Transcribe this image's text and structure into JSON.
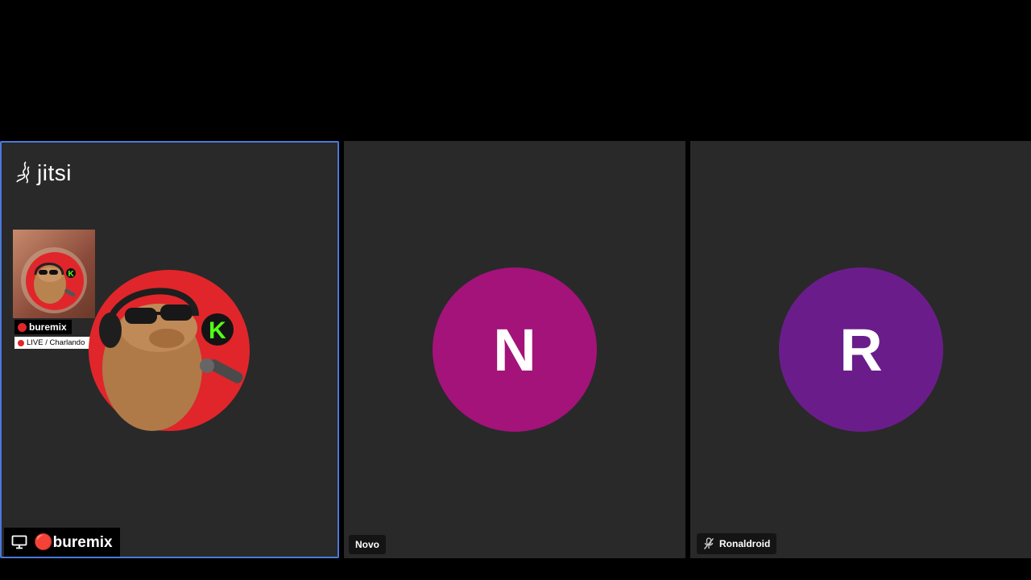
{
  "branding": {
    "watermark": "jitsi"
  },
  "participants": [
    {
      "name": "🔴buremix",
      "stream_overlay": {
        "channel": "buremix",
        "status": "LIVE / Charlando"
      },
      "screen_share": true,
      "active_speaker": true
    },
    {
      "name": "Novo",
      "initial": "N",
      "avatar_color": "#a3137a"
    },
    {
      "name": "Ronaldroid",
      "initial": "R",
      "avatar_color": "#6a1d8a",
      "muted": true
    }
  ],
  "colors": {
    "active_border": "#4a79d9",
    "tile_bg": "#292929",
    "live_red": "#e0262b",
    "kick_green": "#53fc18"
  },
  "icons": [
    "screen-share-icon",
    "mic-muted-icon",
    "jitsi-logo"
  ]
}
